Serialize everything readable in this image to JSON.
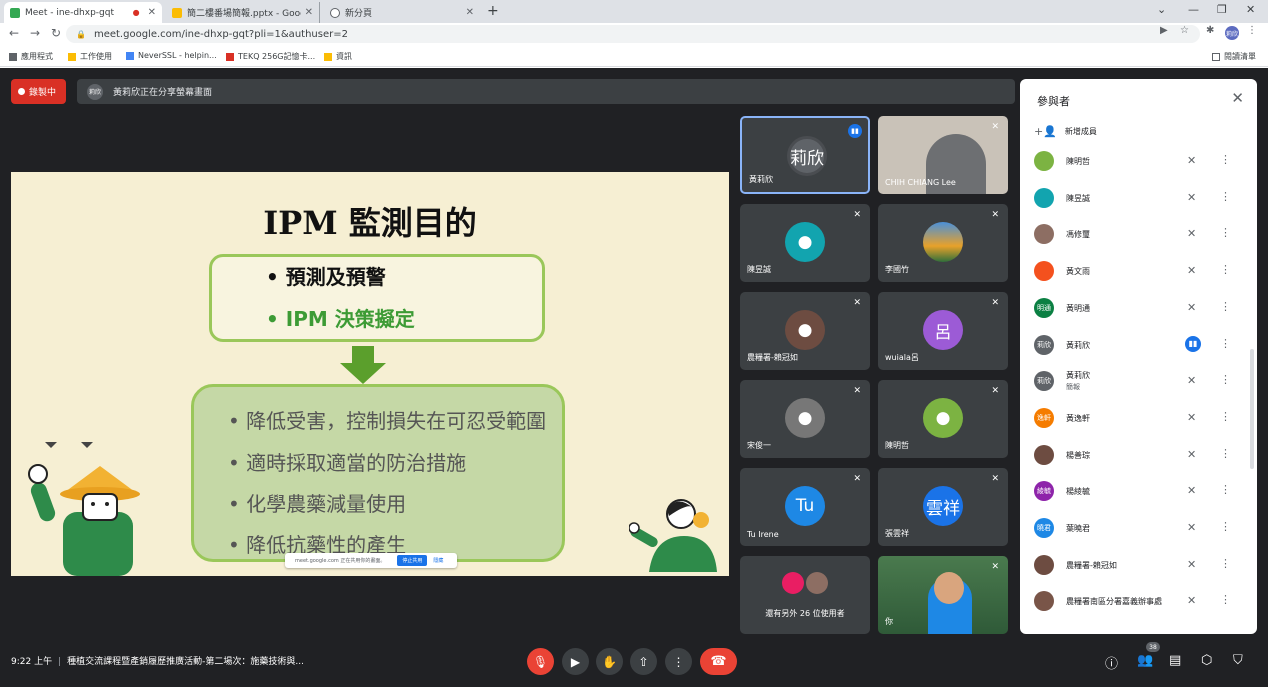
{
  "browser": {
    "tabs": [
      {
        "title": "Meet - ine-dhxp-gqt",
        "active": true,
        "color": "#34a853"
      },
      {
        "title": "簡二樓番場簡報.pptx - Google S",
        "active": false,
        "color": "#fbbc04"
      },
      {
        "title": "新分頁",
        "active": false,
        "color": "#5f6368"
      }
    ],
    "new_tab": "+",
    "url": "meet.google.com/ine-dhxp-gqt?pli=1&authuser=2",
    "profile_initials": "莉欣",
    "bookmarks": [
      {
        "label": "應用程式",
        "color": "#5f6368"
      },
      {
        "label": "工作使用",
        "color": "#fbbc04"
      },
      {
        "label": "NeverSSL - helpin...",
        "color": "#4285f4"
      },
      {
        "label": "TEKQ 256G記憶卡...",
        "color": "#d93025"
      },
      {
        "label": "資訊",
        "color": "#fbbc04"
      }
    ],
    "reading_list": "閱讀清單"
  },
  "meet": {
    "recording_label": "錄製中",
    "presenter_initials": "莉欣",
    "presenter_banner": "黃莉欣正在分享螢幕畫面",
    "slide": {
      "title": "IPM 監測目的",
      "top_bullets": [
        "預測及預警",
        "IPM 決策擬定"
      ],
      "bottom_bullets": [
        "降低受害，控制損失在可忍受範圍",
        "適時採取適當的防治措施",
        "化學農藥減量使用",
        "降低抗藥性的產生"
      ],
      "bullet_char": "•"
    },
    "share_notice": {
      "text": "meet.google.com 正在共用你的畫面。",
      "stop_label": "停止共用",
      "hide_label": "隱藏"
    },
    "tiles": [
      {
        "name": "黃莉欣",
        "initials": "莉欣",
        "color": "#3c4043"
      },
      {
        "name": "CHIH CHIANG Lee",
        "initials": "",
        "color": "#555"
      },
      {
        "name": "陳昱誠",
        "initials": "",
        "color": "#12a4af"
      },
      {
        "name": "李國竹",
        "initials": "",
        "color": "#e8a12a"
      },
      {
        "name": "農糧署-賴冠如",
        "initials": "",
        "color": "#6d4c41"
      },
      {
        "name": "wuiala呂",
        "initials": "呂",
        "color": "#9c5bd6"
      },
      {
        "name": "宋俊一",
        "initials": "",
        "color": "#777"
      },
      {
        "name": "陳明哲",
        "initials": "",
        "color": "#7cb342"
      },
      {
        "name": "Tu Irene",
        "initials": "Tu",
        "color": "#1e88e5"
      },
      {
        "name": "張雲祥",
        "initials": "雲祥",
        "color": "#1a73e8"
      },
      {
        "name": "還有另外 26 位使用者",
        "initials": "",
        "color": "#3c4043"
      },
      {
        "name": "你",
        "initials": "",
        "color": "#4a7a4e"
      }
    ],
    "panel": {
      "title": "參與者",
      "add_label": "新增成員",
      "participants": [
        {
          "name": "陳明哲",
          "sub": "",
          "initials": "",
          "color": "#7cb342",
          "speaking": false
        },
        {
          "name": "陳昱誠",
          "sub": "",
          "initials": "",
          "color": "#12a4af",
          "speaking": false
        },
        {
          "name": "馮修璽",
          "sub": "",
          "initials": "",
          "color": "#8d6e63",
          "speaking": false
        },
        {
          "name": "黃文雨",
          "sub": "",
          "initials": "",
          "color": "#f4511e",
          "speaking": false
        },
        {
          "name": "黃明通",
          "sub": "",
          "initials": "明通",
          "color": "#0b8043",
          "speaking": false
        },
        {
          "name": "黃莉欣",
          "sub": "",
          "initials": "莉欣",
          "color": "#5f6368",
          "speaking": true
        },
        {
          "name": "黃莉欣",
          "sub": "簡報",
          "initials": "莉欣",
          "color": "#5f6368",
          "speaking": false
        },
        {
          "name": "黃逸軒",
          "sub": "",
          "initials": "逸軒",
          "color": "#f57c00",
          "speaking": false
        },
        {
          "name": "楊善琮",
          "sub": "",
          "initials": "",
          "color": "#6d4c41",
          "speaking": false
        },
        {
          "name": "楊綾毓",
          "sub": "",
          "initials": "綾毓",
          "color": "#8e24aa",
          "speaking": false
        },
        {
          "name": "葉曉君",
          "sub": "",
          "initials": "曉君",
          "color": "#1e88e5",
          "speaking": false
        },
        {
          "name": "農糧署-賴冠如",
          "sub": "",
          "initials": "",
          "color": "#6d4c41",
          "speaking": false
        },
        {
          "name": "農糧署南區分署嘉義辦事處",
          "sub": "",
          "initials": "",
          "color": "#795548",
          "speaking": false
        }
      ]
    },
    "bottom": {
      "time": "9:22 上午",
      "meeting_title": "種植交流課程暨產銷履歷推廣活動-第二場次：施藥技術與...",
      "participant_count": "38"
    }
  }
}
